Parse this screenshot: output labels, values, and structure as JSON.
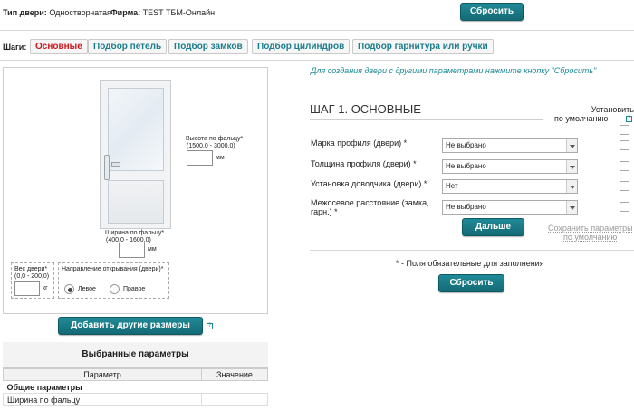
{
  "header": {
    "door_type_label": "Тип двери:",
    "door_type_value": "Одностворчатая",
    "firm_label": "Фирма:",
    "firm_value": "TEST ТБМ-Онлайн",
    "reset_label": "Сбросить"
  },
  "steps": {
    "label": "Шаги:",
    "items": [
      "Основные",
      "Подбор петель",
      "Подбор замков",
      "Подбор цилиндров",
      "Подбор гарнитура или ручки"
    ]
  },
  "door_panel": {
    "height_label": "Высота по фальцу*",
    "height_range": "(1500,0 - 3000,0)",
    "height_unit": "мм",
    "width_label": "Ширина по фальцу*",
    "width_range": "(400,0 - 1600,0)",
    "width_unit": "мм",
    "weight_label": "Вес двери*",
    "weight_range": "(0,0 - 200,0)",
    "weight_unit": "кг",
    "direction_label": "Направление открывания (двери)*",
    "direction_left": "Левое",
    "direction_right": "Правое"
  },
  "add_sizes_label": "Добавить другие размеры",
  "selected_params": {
    "title": "Выбранные параметры",
    "col_param": "Параметр",
    "col_value": "Значение",
    "group": "Общие параметры",
    "rows": [
      "Ширина по фальцу"
    ]
  },
  "form": {
    "hint": "Для создания двери с другими параметрами нажмите кнопку \"Сбросить\"",
    "title": "ШАГ 1. ОСНОВНЫЕ",
    "default_label_1": "Установить",
    "default_label_2": "по умолчанию",
    "fields": [
      {
        "label": "Марка профиля (двери) *",
        "value": "Не выбрано"
      },
      {
        "label": "Толщина профиля (двери) *",
        "value": "Не выбрано"
      },
      {
        "label": "Установка доводчика (двери) *",
        "value": "Нет"
      },
      {
        "label": "Межосевое расстояние (замка, гарн.) *",
        "value": "Не выбрано"
      }
    ],
    "next_label": "Дальше",
    "save_defaults_1": "Сохранить параметры",
    "save_defaults_2": "по умолчанию",
    "required_note": "* - Поля обязательные для заполнения",
    "reset_label": "Сбросить"
  }
}
